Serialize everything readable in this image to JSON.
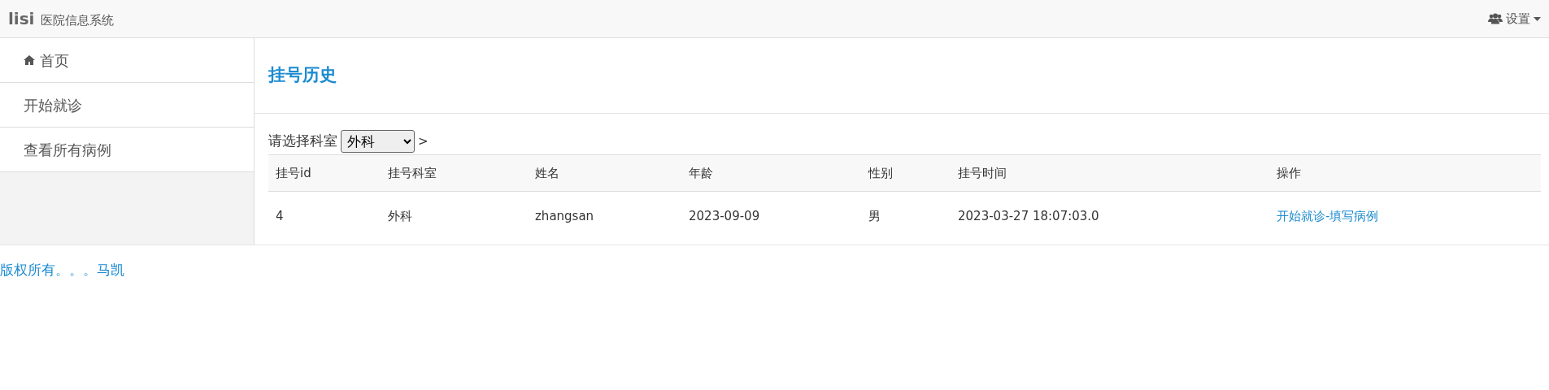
{
  "navbar": {
    "brand": "lisi",
    "subtitle": "医院信息系统",
    "settings_menu": "设置"
  },
  "sidebar": {
    "items": [
      {
        "label": "首页",
        "kind": "with-icon"
      },
      {
        "label": "开始就诊",
        "kind": "plain"
      },
      {
        "label": "查看所有病例",
        "kind": "plain"
      }
    ]
  },
  "content": {
    "title": "挂号历史",
    "filter_label": "请选择科室",
    "department_select": "外科",
    "filter_suffix": ">",
    "table": {
      "columns": [
        "挂号id",
        "挂号科室",
        "姓名",
        "年龄",
        "性别",
        "挂号时间",
        "操作"
      ],
      "rows": [
        {
          "cells": [
            "4",
            "外科",
            "zhangsan",
            "2023-09-09",
            "男",
            "2023-03-27 18:07:03.0"
          ],
          "action": "开始就诊-填写病例"
        }
      ]
    }
  },
  "footer": "版权所有。。。马凯"
}
